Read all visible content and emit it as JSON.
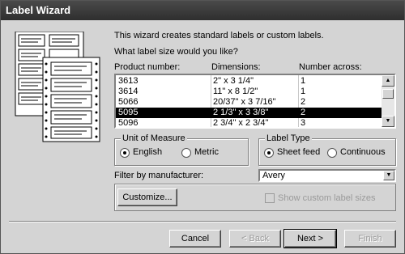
{
  "window": {
    "title": "Label Wizard"
  },
  "intro": "This wizard creates standard labels or custom labels.",
  "question": "What label size would you like?",
  "table": {
    "headers": [
      "Product number:",
      "Dimensions:",
      "Number across:"
    ],
    "rows": [
      [
        "3613",
        "2\" x 3 1/4\"",
        "1"
      ],
      [
        "3614",
        "11\" x 8 1/2\"",
        "1"
      ],
      [
        "5066",
        "20/37\" x 3 7/16\"",
        "2"
      ],
      [
        "5095",
        "2 1/3\" x 3 3/8\"",
        "2"
      ],
      [
        "5096",
        "2 3/4\" x 2 3/4\"",
        "3"
      ]
    ],
    "selected_row": 3
  },
  "unit_of_measure": {
    "label": "Unit of Measure",
    "options": [
      "English",
      "Metric"
    ],
    "selected": "English"
  },
  "label_type": {
    "label": "Label Type",
    "options": [
      "Sheet feed",
      "Continuous"
    ],
    "selected": "Sheet feed"
  },
  "filter": {
    "label": "Filter by  manufacturer:",
    "value": "Avery"
  },
  "customize_label": "Customize...",
  "show_custom": {
    "label": "Show custom label sizes",
    "checked": false
  },
  "buttons": {
    "cancel": "Cancel",
    "back": "< Back",
    "next": "Next >",
    "finish": "Finish"
  },
  "icons": {
    "scroll_up": "scroll-up-arrow-icon",
    "scroll_down": "scroll-down-arrow-icon",
    "dropdown": "dropdown-arrow-icon",
    "illustration": "label-sheet-illustration"
  }
}
